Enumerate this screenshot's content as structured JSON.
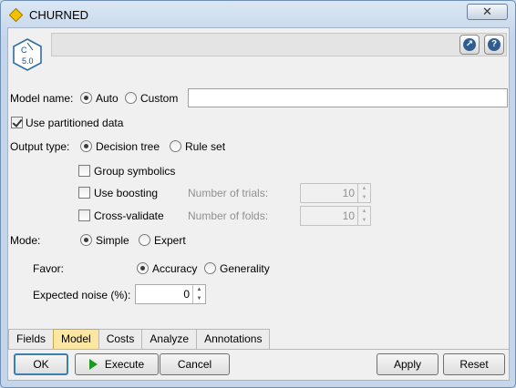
{
  "window": {
    "title": "CHURNED",
    "close_glyph": "✕"
  },
  "header": {
    "node_icon": "c50-node-icon",
    "node_icon_text": "C\n5.0",
    "launch_glyph": "↗",
    "help_glyph": "?"
  },
  "model_name": {
    "label": "Model name:",
    "options": [
      "Auto",
      "Custom"
    ],
    "selected": "Auto",
    "custom_value": ""
  },
  "partitioned": {
    "label": "Use partitioned data",
    "checked": true
  },
  "output_type": {
    "label": "Output type:",
    "options": [
      "Decision tree",
      "Rule set"
    ],
    "selected": "Decision tree"
  },
  "group_symbolics": {
    "label": "Group symbolics",
    "checked": false
  },
  "use_boosting": {
    "label": "Use boosting",
    "checked": false,
    "trials_label": "Number of trials:",
    "trials_value": "10"
  },
  "cross_validate": {
    "label": "Cross-validate",
    "checked": false,
    "folds_label": "Number of folds:",
    "folds_value": "10"
  },
  "mode": {
    "label": "Mode:",
    "options": [
      "Simple",
      "Expert"
    ],
    "selected": "Simple"
  },
  "favor": {
    "label": "Favor:",
    "options": [
      "Accuracy",
      "Generality"
    ],
    "selected": "Accuracy"
  },
  "expected_noise": {
    "label": "Expected noise (%):",
    "value": "0"
  },
  "tabs": [
    "Fields",
    "Model",
    "Costs",
    "Analyze",
    "Annotations"
  ],
  "active_tab": "Model",
  "buttons": {
    "ok": "OK",
    "execute": "Execute",
    "cancel": "Cancel",
    "apply": "Apply",
    "reset": "Reset"
  },
  "colors": {
    "active_tab": "#fbe7a1",
    "execute_icon": "#1d9a1d",
    "help_icon": "#2f5d92"
  }
}
